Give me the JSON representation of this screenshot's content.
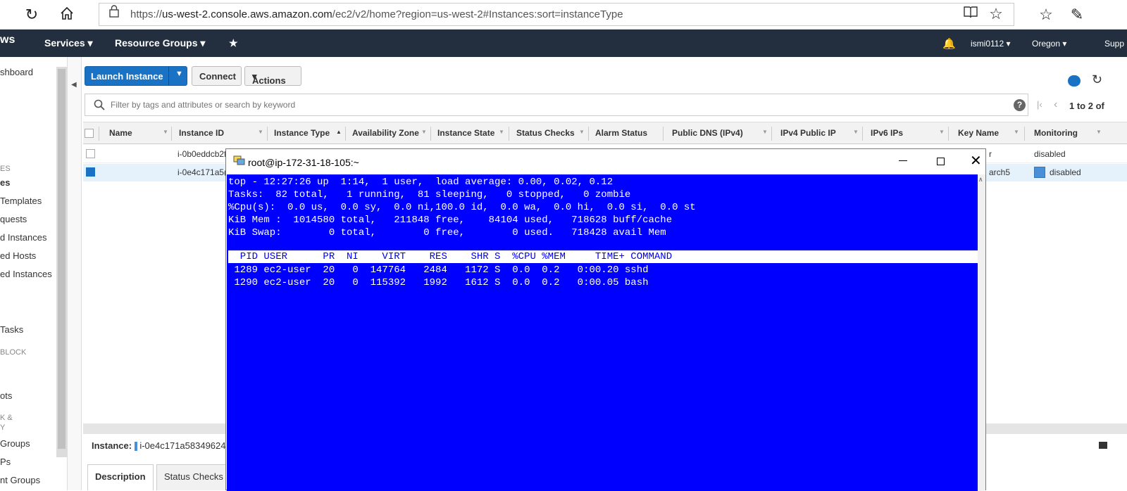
{
  "browser": {
    "url_prefix": "https://",
    "url_host": "us-west-2.console.aws.amazon.com",
    "url_path": "/ec2/v2/home?region=us-west-2#Instances:sort=instanceType"
  },
  "nav": {
    "logo": "ws",
    "services": "Services",
    "resource_groups": "Resource Groups",
    "user": "ismi0112",
    "region": "Oregon",
    "support": "Supp"
  },
  "sidebar": {
    "items": [
      "shboard",
      "ES",
      "es",
      "Templates",
      "quests",
      "d Instances",
      "ed Hosts",
      "ed Instances",
      "Tasks",
      "BLOCK",
      "ots",
      "K &",
      "Y",
      "Groups",
      "Ps",
      "nt Groups"
    ]
  },
  "toolbar": {
    "launch": "Launch Instance",
    "connect": "Connect",
    "actions": "Actions"
  },
  "filter": {
    "placeholder": "Filter by tags and attributes or search by keyword",
    "pagination": "1 to 2 of"
  },
  "table": {
    "headers": [
      "Name",
      "Instance ID",
      "Instance Type",
      "Availability Zone",
      "Instance State",
      "Status Checks",
      "Alarm Status",
      "Public DNS (IPv4)",
      "IPv4 Public IP",
      "IPv6 IPs",
      "Key Name",
      "Monitoring"
    ],
    "rows": [
      {
        "id": "i-0b0eddcb2f",
        "key": "r",
        "monitoring": "disabled"
      },
      {
        "id": "i-0e4c171a5(",
        "key": "arch5",
        "monitoring": "disabled"
      }
    ]
  },
  "details": {
    "label": "Instance:",
    "value": "i-0e4c171a583496240",
    "tabs": [
      "Description",
      "Status Checks"
    ]
  },
  "terminal": {
    "title": "root@ip-172-31-18-105:~",
    "lines": [
      "top - 12:27:26 up  1:14,  1 user,  load average: 0.00, 0.02, 0.12",
      "Tasks:  82 total,   1 running,  81 sleeping,   0 stopped,   0 zombie",
      "%Cpu(s):  0.0 us,  0.0 sy,  0.0 ni,100.0 id,  0.0 wa,  0.0 hi,  0.0 si,  0.0 st",
      "KiB Mem :  1014580 total,   211848 free,    84104 used,   718628 buff/cache",
      "KiB Swap:        0 total,        0 free,        0 used.   718428 avail Mem"
    ],
    "header": "  PID USER      PR  NI    VIRT    RES    SHR S  %CPU %MEM     TIME+ COMMAND",
    "processes": [
      " 1289 ec2-user  20   0  147764   2484   1172 S  0.0  0.2   0:00.20 sshd",
      " 1290 ec2-user  20   0  115392   1992   1612 S  0.0  0.2   0:00.05 bash"
    ]
  }
}
